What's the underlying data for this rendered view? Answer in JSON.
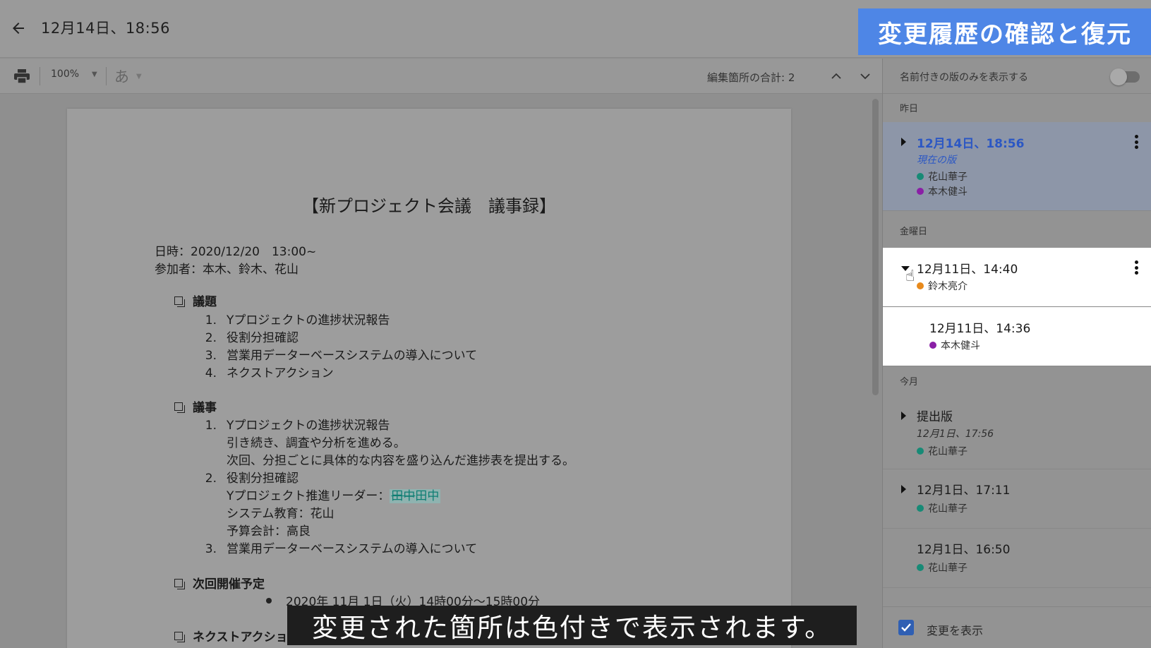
{
  "header": {
    "title": "12月14日、18:56",
    "banner": "変更履歴の確認と復元"
  },
  "toolbar": {
    "zoom": "100%",
    "input_mode": "あ",
    "edit_count": "編集箇所の合計: 2"
  },
  "document": {
    "heading": "【新プロジェクト会議　議事録】",
    "date_line": "日時：2020/12/20　13:00~",
    "attendees_line": "参加者：本木、鈴木、花山",
    "sections": [
      {
        "title": "議題",
        "items": [
          "Yプロジェクトの進捗状況報告",
          "役割分担確認",
          "営業用データーベースシステムの導入について",
          "ネクストアクション"
        ]
      },
      {
        "title": "議事",
        "item1": "Yプロジェクトの進捗状況報告",
        "item1_lines": [
          "引き続き、調査や分析を進める。",
          "次回、分担ごとに具体的な内容を盛り込んだ進捗表を提出する。"
        ],
        "item2": "役割分担確認",
        "leader_label": "Yプロジェクト推進リーダー：",
        "leader_removed": "田中",
        "leader_added": "田中",
        "item2_lines": [
          "システム教育：花山",
          "予算会計：高良"
        ],
        "item3": "営業用データーベースシステムの導入について"
      },
      {
        "title": "次回開催予定",
        "bullet": "2020年 11月 1日（火）14時00分～15時00分"
      },
      {
        "title": "ネクストアクション"
      }
    ],
    "numbers": [
      "1.",
      "2.",
      "3.",
      "4."
    ]
  },
  "caption": "変更された箇所は色付きで表示されます。",
  "sidebar": {
    "toggle_label": "名前付きの版のみを表示する",
    "groups": [
      {
        "label": "昨日"
      },
      {
        "label": "金曜日"
      },
      {
        "label": "今月"
      }
    ],
    "versions": [
      {
        "title": "12月14日、18:56",
        "subtitle": "現在の版",
        "users": [
          "花山華子",
          "本木健斗"
        ]
      },
      {
        "title": "12月11日、14:40",
        "users": [
          "鈴木亮介"
        ]
      },
      {
        "title": "12月11日、14:36",
        "users": [
          "本木健斗"
        ]
      },
      {
        "title": "提出版",
        "subtitle": "12月1日、17:56",
        "users": [
          "花山華子"
        ]
      },
      {
        "title": "12月1日、17:11",
        "users": [
          "花山華子"
        ]
      },
      {
        "title": "12月1日、16:50",
        "users": [
          "花山華子"
        ]
      }
    ],
    "show_changes_label": "変更を表示"
  },
  "colors": {
    "banner": "#4e86e6",
    "selected_version": "#2b57c4",
    "user_hanayama": "#178a76",
    "user_motoki": "#8a1fa6",
    "user_suzuki": "#e88a1c",
    "change_highlight": "#0e7e73"
  }
}
